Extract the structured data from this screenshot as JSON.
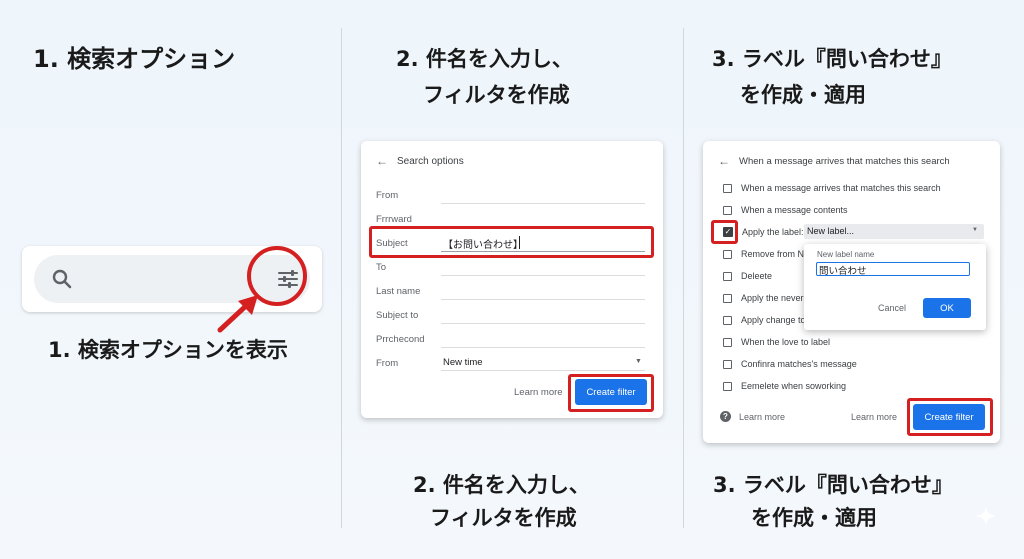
{
  "col1": {
    "title": "1. 検索オプション",
    "caption": "1. 検索オプションを表示"
  },
  "col2": {
    "title_line1": "2. 件名を入力し、",
    "title_line2": "フィルタを作成",
    "footer_line1": "2. 件名を入力し、",
    "footer_line2": "フィルタを作成",
    "panel": {
      "back_icon": "←",
      "header": "Search options",
      "fields": [
        {
          "label": "From"
        },
        {
          "label": "Frrrward"
        },
        {
          "label": "Subject"
        },
        {
          "label": "To"
        },
        {
          "label": "Last name"
        },
        {
          "label": "Subject to"
        },
        {
          "label": "Prrchecond"
        },
        {
          "label": "From"
        }
      ],
      "subject_value": "【お問い合わせ】",
      "select_value": "New time",
      "learn_more": "Learn more",
      "create_filter": "Create filter"
    }
  },
  "col3": {
    "title_line1": "3. ラベル『問い合わせ』",
    "title_line2": "を作成・適用",
    "footer_line1": "3. ラベル『問い合わせ』",
    "footer_line2": "を作成・適用",
    "panel": {
      "back_icon": "←",
      "header": "When a message arrives that matches this search",
      "rows": [
        {
          "text": "When a message arrives that matches this search",
          "checked": false
        },
        {
          "text": "When a message contents",
          "checked": false
        },
        {
          "text": "Apply the label:",
          "checked": true
        },
        {
          "text": "Remove from N",
          "checked": false
        },
        {
          "text": "Deleete",
          "checked": false
        },
        {
          "text": "Apply the never",
          "checked": false
        },
        {
          "text": "Apply change to",
          "checked": false
        },
        {
          "text": "When the love to label",
          "checked": false
        },
        {
          "text": "Confinra matches's message",
          "checked": false
        },
        {
          "text": "Eemelete when soworking",
          "checked": false
        }
      ],
      "label_select": "New label...",
      "popup": {
        "title": "New label name",
        "value": "問い合わせ",
        "cancel": "Cancel",
        "ok": "OK"
      },
      "help_icon": "?",
      "learn_more_left": "Learn more",
      "learn_more_right": "Learn more",
      "create_filter": "Create filter"
    }
  },
  "colors": {
    "accent_red": "#d42020",
    "button_blue": "#1a73e8",
    "background": "#eef5fb"
  }
}
